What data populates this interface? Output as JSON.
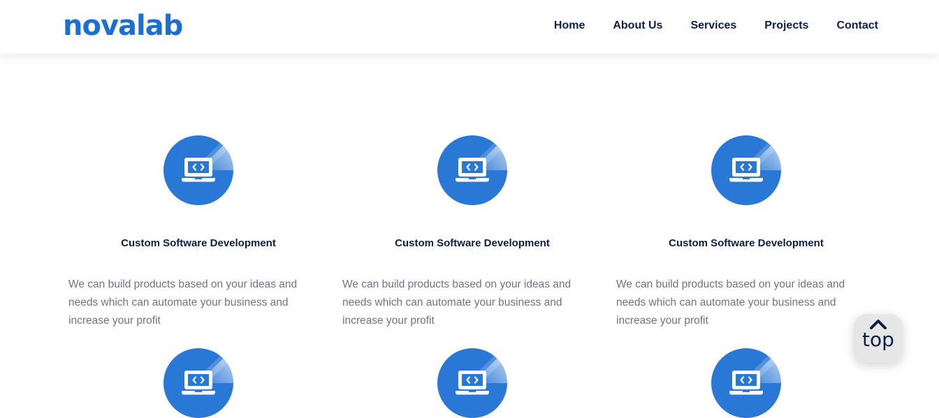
{
  "header": {
    "logo": "novalab",
    "nav": [
      "Home",
      "About Us",
      "Services",
      "Projects",
      "Contact"
    ]
  },
  "services": [
    {
      "icon": "laptop-code-icon",
      "title": "Custom Software Development",
      "description": "We can build products based on your ideas and needs which can automate your business and increase your profit"
    },
    {
      "icon": "laptop-code-icon",
      "title": "Custom Software Development",
      "description": "We can build products based on your ideas and needs which can automate your business and increase your profit"
    },
    {
      "icon": "laptop-code-icon",
      "title": "Custom Software Development",
      "description": "We can build products based on your ideas and needs which can automate your business and increase your profit"
    },
    {
      "icon": "laptop-code-icon"
    },
    {
      "icon": "laptop-code-icon"
    },
    {
      "icon": "laptop-code-icon"
    }
  ],
  "scroll_top": {
    "label": "top",
    "icon": "chevron-up-icon"
  },
  "colors": {
    "brand": "#1b6fd4",
    "icon_bg": "#2a78d6",
    "heading": "#0e1f47",
    "text": "#6e7484"
  }
}
